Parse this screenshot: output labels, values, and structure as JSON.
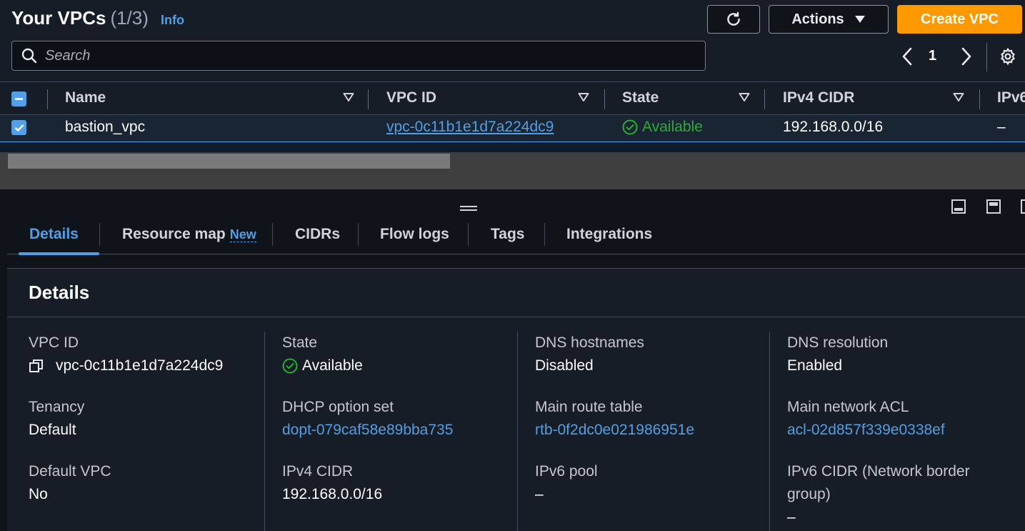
{
  "header": {
    "title": "Your VPCs",
    "count": "(1/3)",
    "info_link": "Info",
    "actions_label": "Actions",
    "create_label": "Create VPC",
    "search_placeholder": "Search",
    "page_number": "1"
  },
  "table": {
    "columns": [
      "Name",
      "VPC ID",
      "State",
      "IPv4 CIDR",
      "IPv6"
    ],
    "rows": [
      {
        "name": "bastion_vpc",
        "vpc_id": "vpc-0c11b1e1d7a224dc9",
        "state": "Available",
        "ipv4_cidr": "192.168.0.0/16",
        "ipv6": "–"
      }
    ]
  },
  "panel": {
    "tabs": [
      {
        "label": "Details"
      },
      {
        "label": "Resource map",
        "badge": "New"
      },
      {
        "label": "CIDRs"
      },
      {
        "label": "Flow logs"
      },
      {
        "label": "Tags"
      },
      {
        "label": "Integrations"
      }
    ],
    "details_title": "Details",
    "fields": {
      "vpc_id": {
        "label": "VPC ID",
        "value": "vpc-0c11b1e1d7a224dc9"
      },
      "state": {
        "label": "State",
        "value": "Available"
      },
      "dns_hostnames": {
        "label": "DNS hostnames",
        "value": "Disabled"
      },
      "dns_resolution": {
        "label": "DNS resolution",
        "value": "Enabled"
      },
      "tenancy": {
        "label": "Tenancy",
        "value": "Default"
      },
      "dhcp": {
        "label": "DHCP option set",
        "value": "dopt-079caf58e89bba735"
      },
      "main_route_table": {
        "label": "Main route table",
        "value": "rtb-0f2dc0e021986951e"
      },
      "main_acl": {
        "label": "Main network ACL",
        "value": "acl-02d857f339e0338ef"
      },
      "default_vpc": {
        "label": "Default VPC",
        "value": "No"
      },
      "ipv4_cidr": {
        "label": "IPv4 CIDR",
        "value": "192.168.0.0/16"
      },
      "ipv6_pool": {
        "label": "IPv6 pool",
        "value": "–"
      },
      "ipv6_cidr": {
        "label": "IPv6 CIDR (Network border group)",
        "value": "–"
      }
    }
  },
  "colors": {
    "accent_orange": "#ff9900",
    "link_blue": "#539fe5",
    "status_green": "#29ad32"
  }
}
